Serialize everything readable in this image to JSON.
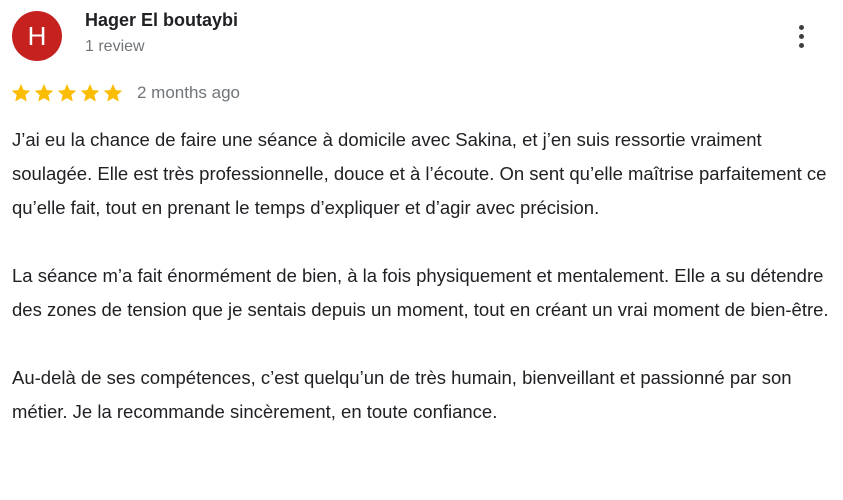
{
  "review": {
    "avatar_letter": "H",
    "avatar_color": "#c5221f",
    "author_name": "Hager El boutaybi",
    "review_count": "1 review",
    "more_icon": "more-vert-icon",
    "rating": 5,
    "rating_max": 5,
    "star_color": "#fbbc04",
    "date": "2 months ago",
    "paragraphs": [
      "J’ai eu la chance de faire une séance à domicile avec Sakina, et j’en suis ressortie vraiment soulagée. Elle est très professionnelle, douce et à l’écoute. On sent qu’elle maîtrise parfaitement ce qu’elle fait, tout en prenant le temps d’expliquer et d’agir avec précision.",
      "La séance m’a fait énormément de bien, à la fois physiquement et mentalement. Elle a su détendre des zones de tension que je sentais depuis un moment, tout en créant un vrai moment de bien-être.",
      "Au-delà de ses compétences, c’est quelqu’un de très humain, bienveillant et passionné par son métier. Je la recommande sincèrement, en toute confiance."
    ]
  }
}
